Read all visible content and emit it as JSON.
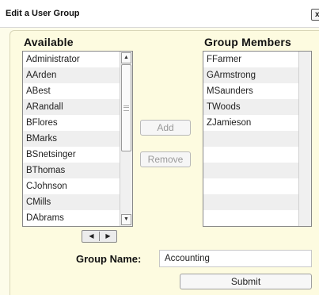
{
  "dialog": {
    "title": "Edit a User Group",
    "close_label": "x"
  },
  "available": {
    "title": "Available",
    "items": [
      "Administrator",
      "AArden",
      "ABest",
      "ARandall",
      "BFlores",
      "BMarks",
      "BSnetsinger",
      "BThomas",
      "CJohnson",
      "CMills",
      "DAbrams"
    ]
  },
  "members": {
    "title": "Group Members",
    "items": [
      "FFarmer",
      "GArmstrong",
      "MSaunders",
      "TWoods",
      "ZJamieson",
      "",
      "",
      "",
      "",
      "",
      "",
      ""
    ]
  },
  "actions": {
    "add_label": "Add",
    "remove_label": "Remove"
  },
  "form": {
    "group_name_label": "Group Name:",
    "group_name_value": "Accounting",
    "submit_label": "Submit"
  },
  "icons": {
    "scroll_up": "chevron-up-icon",
    "scroll_down": "chevron-down-icon",
    "scroll_left": "chevron-left-icon",
    "scroll_right": "chevron-right-icon"
  }
}
